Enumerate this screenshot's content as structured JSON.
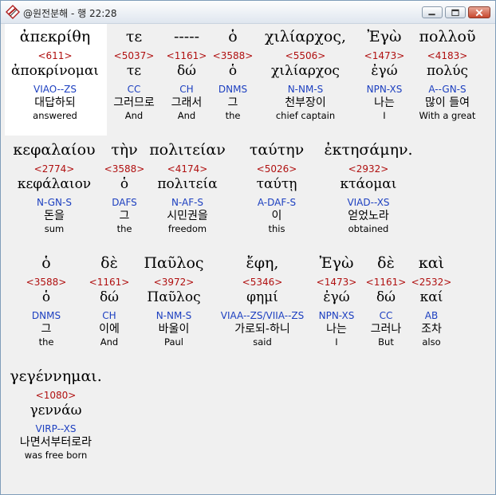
{
  "window": {
    "title": "@원전분해 - 행 22:28"
  },
  "colors": {
    "strong": "#b01010",
    "morph": "#1c3fc0",
    "highlight": "#ffffff"
  },
  "rows": [
    {
      "words": [
        {
          "greek": "ἀπεκρίθη",
          "strong": "<611>",
          "lemma": "ἀποκρίνομαι",
          "morph": "VIAO--ZS",
          "korean": "대답하되",
          "english": "answered"
        },
        {
          "greek": "τε",
          "strong": "<5037>",
          "lemma": "τε",
          "morph": "CC",
          "korean": "그러므로",
          "english": "And"
        },
        {
          "greek": "-----",
          "strong": "<1161>",
          "lemma": "δώ",
          "morph": "CH",
          "korean": "그래서",
          "english": "And"
        },
        {
          "greek": "ὁ",
          "strong": "<3588>",
          "lemma": "ὁ",
          "morph": "DNMS",
          "korean": "그",
          "english": "the"
        },
        {
          "greek": "χιλίαρχος,",
          "strong": "<5506>",
          "lemma": "χιλίαρχος",
          "morph": "N-NM-S",
          "korean": "천부장이",
          "english": "chief captain"
        },
        {
          "greek": "Ἐγὼ",
          "strong": "<1473>",
          "lemma": "ἐγώ",
          "morph": "NPN-XS",
          "korean": "나는",
          "english": "I"
        },
        {
          "greek": "πολλοῦ",
          "strong": "<4183>",
          "lemma": "πολύς",
          "morph": "A--GN-S",
          "korean": "많이 들여",
          "english": "With a great"
        }
      ]
    },
    {
      "words": [
        {
          "greek": "κεφαλαίου",
          "strong": "<2774>",
          "lemma": "κεφάλαιον",
          "morph": "N-GN-S",
          "korean": "돈을",
          "english": "sum"
        },
        {
          "greek": "τὴν",
          "strong": "<3588>",
          "lemma": "ὁ",
          "morph": "DAFS",
          "korean": "그",
          "english": "the"
        },
        {
          "greek": "πολιτείαν",
          "strong": "<4174>",
          "lemma": "πολιτεία",
          "morph": "N-AF-S",
          "korean": "시민권을",
          "english": "freedom"
        },
        {
          "greek": "ταύτην",
          "strong": "<5026>",
          "lemma": "ταύτῃ",
          "morph": "A-DAF-S",
          "korean": "이",
          "english": "this"
        },
        {
          "greek": "ἐκτησάμην.",
          "strong": "<2932>",
          "lemma": "κτάομαι",
          "morph": "VIAD--XS",
          "korean": "얻었노라",
          "english": "obtained"
        }
      ]
    },
    {
      "words": [
        {
          "greek": "ὁ",
          "strong": "<3588>",
          "lemma": "ὁ",
          "morph": "DNMS",
          "korean": "그",
          "english": "the"
        },
        {
          "greek": "δὲ",
          "strong": "<1161>",
          "lemma": "δώ",
          "morph": "CH",
          "korean": "이에",
          "english": "And"
        },
        {
          "greek": "Παῦλος",
          "strong": "<3972>",
          "lemma": "Παῦλος",
          "morph": "N-NM-S",
          "korean": "바울이",
          "english": "Paul"
        },
        {
          "greek": "ἔφη,",
          "strong": "<5346>",
          "lemma": "φημί",
          "morph": "VIAA--ZS/VIIA--ZS",
          "korean": "가로되-하니",
          "english": "said"
        },
        {
          "greek": "Ἐγὼ",
          "strong": "<1473>",
          "lemma": "ἐγώ",
          "morph": "NPN-XS",
          "korean": "나는",
          "english": "I"
        },
        {
          "greek": "δὲ",
          "strong": "<1161>",
          "lemma": "δώ",
          "morph": "CC",
          "korean": "그러나",
          "english": "But"
        },
        {
          "greek": "καὶ",
          "strong": "<2532>",
          "lemma": "καί",
          "morph": "AB",
          "korean": "조차",
          "english": "also"
        }
      ]
    },
    {
      "words": [
        {
          "greek": "γεγέννημαι.",
          "strong": "<1080>",
          "lemma": "γεννάω",
          "morph": "VIRP--XS",
          "korean": "나면서부터로라",
          "english": "was free born"
        }
      ]
    }
  ]
}
